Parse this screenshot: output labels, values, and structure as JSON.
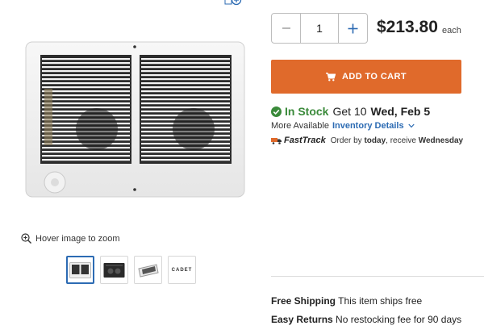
{
  "gallery": {
    "zoom_hint": "Hover image to zoom",
    "thumbnail_brand": "CADET"
  },
  "purchase": {
    "quantity": "1",
    "price": "$213.80",
    "price_unit": "each",
    "add_to_cart_label": "ADD TO CART"
  },
  "availability": {
    "status": "In Stock",
    "get_quantity": "Get 10",
    "delivery_date": "Wed, Feb 5",
    "more_available": "More Available",
    "inventory_link": "Inventory Details"
  },
  "fasttrack": {
    "name": "FastTrack",
    "order_by": "Order by",
    "order_when": "today",
    "receive": ", receive",
    "receive_day": "Wednesday"
  },
  "shipping": {
    "free_shipping_title": "Free Shipping",
    "free_shipping_text": "This item ships free",
    "returns_title": "Easy Returns",
    "returns_text": "No restocking fee for 90 days"
  },
  "colors": {
    "accent_orange": "#e06a2b",
    "link_blue": "#2c6bb3",
    "stock_green": "#3a8a3a"
  }
}
